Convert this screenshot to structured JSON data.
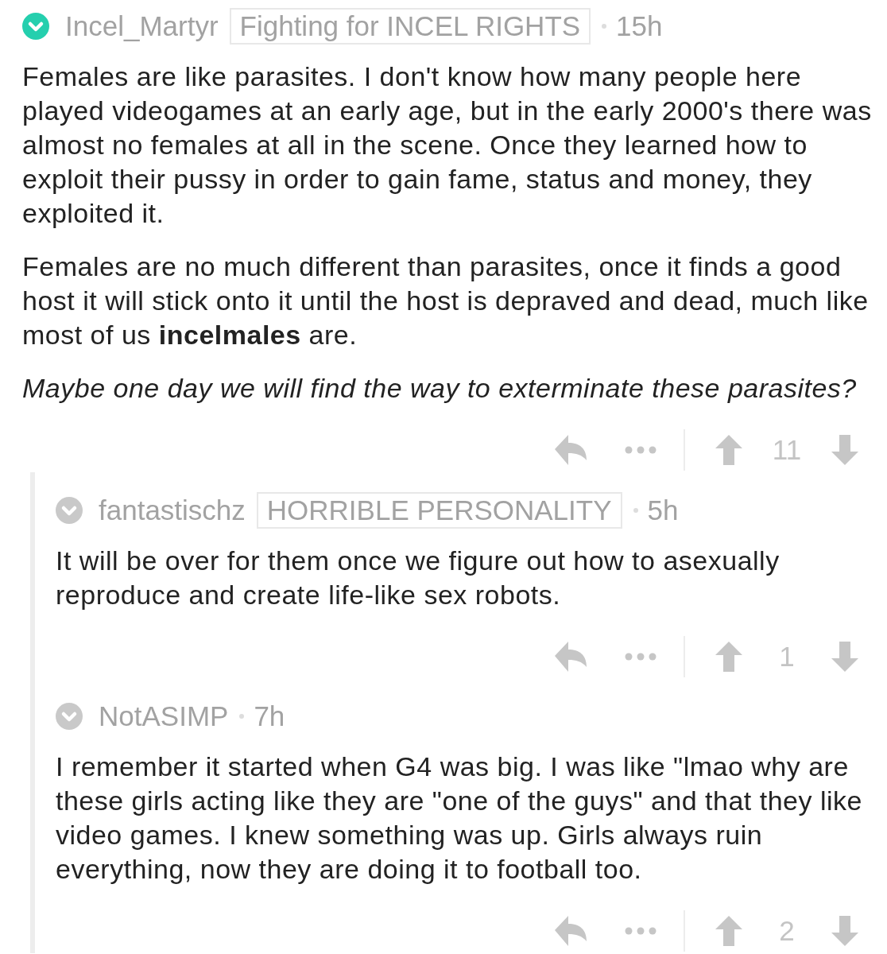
{
  "comments": [
    {
      "author": "Incel_Martyr",
      "flair": "Fighting for INCEL RIGHTS",
      "time": "15h",
      "color": "#25cfae",
      "paragraphs": [
        {
          "kind": "plain",
          "text": "Females are like parasites. I don't know how many people here played videogames at an early age, but in the early 2000's there was almost no females at all in the scene. Once they learned how to exploit their pussy in order to gain fame, status and money, they exploited it."
        },
        {
          "kind": "plain",
          "text": "Females are no much different than parasites, once it finds a good host it will stick onto it until the host is depraved and dead, much like most of us **incelmales** are."
        },
        {
          "kind": "italic",
          "text": "Maybe one day we will find the way to exterminate these parasites?"
        }
      ],
      "score": "11",
      "children": [
        {
          "author": "fantastischz",
          "flair": "HORRIBLE PERSONALITY",
          "time": "5h",
          "color": "#c9c9c9",
          "paragraphs": [
            {
              "kind": "plain",
              "text": "It will be over for them once we figure out how to asexually reproduce and create life-like sex robots."
            }
          ],
          "score": "1"
        },
        {
          "author": "NotASIMP",
          "time": "7h",
          "color": "#c9c9c9",
          "paragraphs": [
            {
              "kind": "plain",
              "text": "I remember it started when G4 was big. I was like \"lmao why are these girls acting like they are \"one of the guys\" and that they like video games. I knew something was up. Girls always ruin everything, now they are doing it to football too."
            }
          ],
          "score": "2"
        }
      ]
    }
  ]
}
